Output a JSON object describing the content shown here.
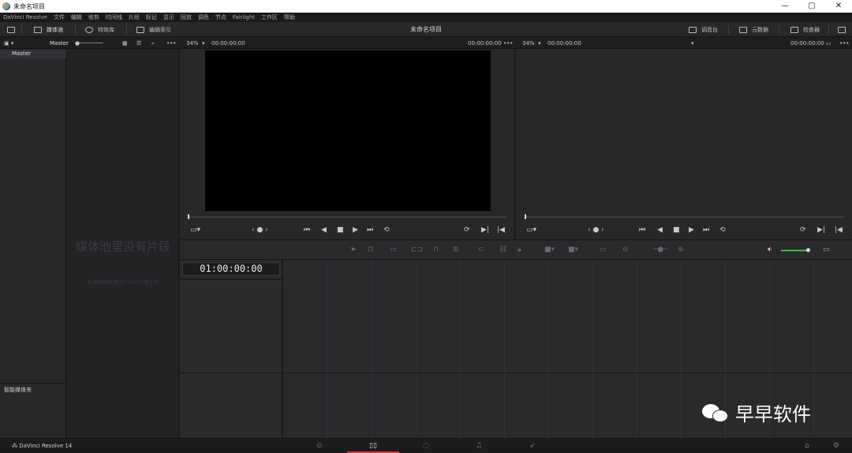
{
  "window": {
    "title": "未命名项目",
    "minimize_icon": "—",
    "maximize_icon": "▢",
    "close_icon": "✕"
  },
  "menu": [
    "DaVinci Resolve",
    "文件",
    "编辑",
    "修剪",
    "时间线",
    "片段",
    "标记",
    "显示",
    "回放",
    "调色",
    "节点",
    "Fairlight",
    "工作区",
    "帮助"
  ],
  "toolbar": {
    "media_pool": "媒体池",
    "effects_library": "特效库",
    "edit_index": "编辑索引",
    "project_title": "未命名项目",
    "mixer": "调音台",
    "metadata": "元数据",
    "inspector": "检查器"
  },
  "subbar": {
    "bin": "Master",
    "src_zoom": "34%",
    "src_tc_left": "00:00:00:00",
    "src_tc_right": "00:00:00:00",
    "tl_zoom": "34%",
    "tl_tc_left": "00:00:00:00",
    "tl_tc_right": "00:00:00:00"
  },
  "bins": {
    "master": "Master",
    "smart_bins": "智能媒体夹"
  },
  "media_pool": {
    "empty_title": "媒体池里没有片段",
    "empty_hint": "从媒体存储添加片段以开始工作"
  },
  "timeline": {
    "timecode": "01:00:00:00"
  },
  "bottom": {
    "app_version": "DaVinci Resolve 14",
    "pages": [
      "media-icon",
      "edit-icon",
      "color-icon",
      "fairlight-icon",
      "deliver-icon"
    ],
    "active_page": "edit",
    "accent": "#e0303a"
  },
  "watermark": "早早软件"
}
